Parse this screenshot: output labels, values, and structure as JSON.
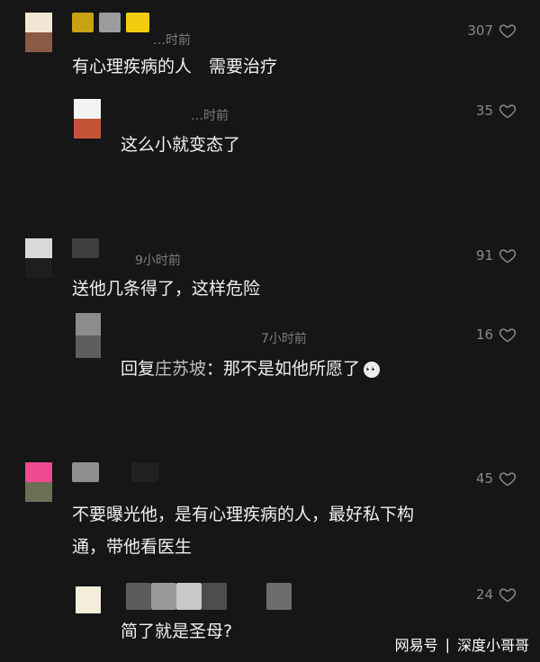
{
  "comments": [
    {
      "name_time": "…时前",
      "text": "有心理疾病的人　需要治疗",
      "likes": "307",
      "reply": {
        "name_time": "…时前",
        "text": "这么小就变态了",
        "likes": "35"
      }
    },
    {
      "name_time": "9小时前",
      "text": "送他几条得了，这样危险",
      "likes": "91",
      "reply": {
        "name_time": "7小时前",
        "prefix": "回复",
        "mention": "庄苏坡",
        "colon": "：",
        "text": "那不是如他所愿了",
        "emoji_label": "👀",
        "likes": "16"
      }
    },
    {
      "name_time": "",
      "text_line1": "不要曝光他，是有心理疾病的人，最好私下构",
      "text_line2": "通，带他看医生",
      "likes": "45",
      "reply": {
        "name_time": "",
        "text": "简了就是圣母?",
        "likes": "24"
      }
    }
  ],
  "watermark": {
    "brand": "网易号",
    "sep": "|",
    "author": "深度小哥哥"
  },
  "colors": {
    "background": "#161616",
    "text": "#f0f0f0",
    "meta": "#7d7d7d",
    "like": "#8a8a8a"
  }
}
